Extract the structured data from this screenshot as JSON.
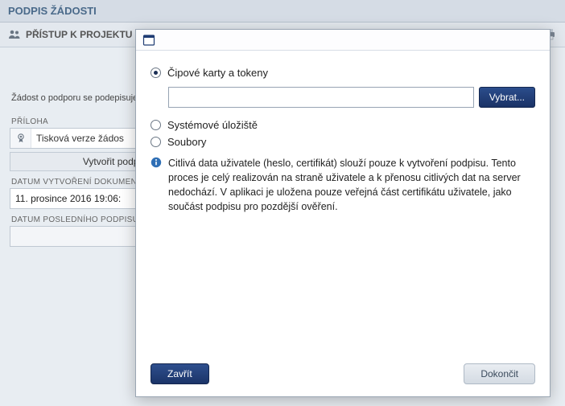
{
  "header": {
    "title": "PODPIS ŽÁDOSTI"
  },
  "toolbar": {
    "access_label": "PŘÍSTUP K PROJEKTU"
  },
  "page": {
    "signing_note": "Žádost o podporu se podepisuje",
    "attachment_label": "PŘÍLOHA",
    "attachment_value": "Tisková verze žádos",
    "create_signature_label": "Vytvořit podpis",
    "doc_created_label": "DATUM VYTVOŘENÍ DOKUMENTU",
    "doc_created_value": "11. prosince 2016 19:06:",
    "last_signed_label": "DATUM POSLEDNÍHO PODPISU D",
    "last_signed_value": ""
  },
  "modal": {
    "options": {
      "chip_cards": "Čipové karty a tokeny",
      "system_store": "Systémové úložiště",
      "files": "Soubory"
    },
    "choose_button": "Vybrat...",
    "chooser_value": "",
    "info_text": "Citlivá data uživatele (heslo, certifikát) slouží pouze k vytvoření podpisu. Tento proces je celý realizován na straně uživatele a k přenosu citlivých dat na server nedochází. V aplikaci je uložena pouze veřejná část certifikátu uživatele, jako součást podpisu pro pozdější ověření.",
    "close_button": "Zavřít",
    "finish_button": "Dokončit"
  }
}
